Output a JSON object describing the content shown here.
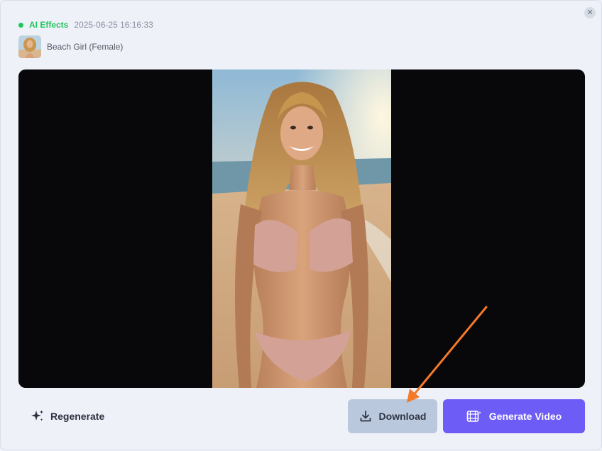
{
  "header": {
    "effect_label": "AI Effects",
    "timestamp": "2025-06-25 16:16:33",
    "close_icon": "close-icon"
  },
  "template": {
    "name": "Beach Girl (Female)"
  },
  "actions": {
    "regenerate_label": "Regenerate",
    "download_label": "Download",
    "generate_video_label": "Generate Video"
  },
  "colors": {
    "status_green": "#22c55e",
    "download_bg": "#b9c8dc",
    "generate_bg": "#6e5cf6",
    "annotation_arrow": "#f47a2a",
    "preview_bg": "#08080a"
  },
  "icons": {
    "status": "status-dot",
    "regenerate": "sparkle-icon",
    "download": "download-icon",
    "generate_video": "video-film-icon"
  }
}
